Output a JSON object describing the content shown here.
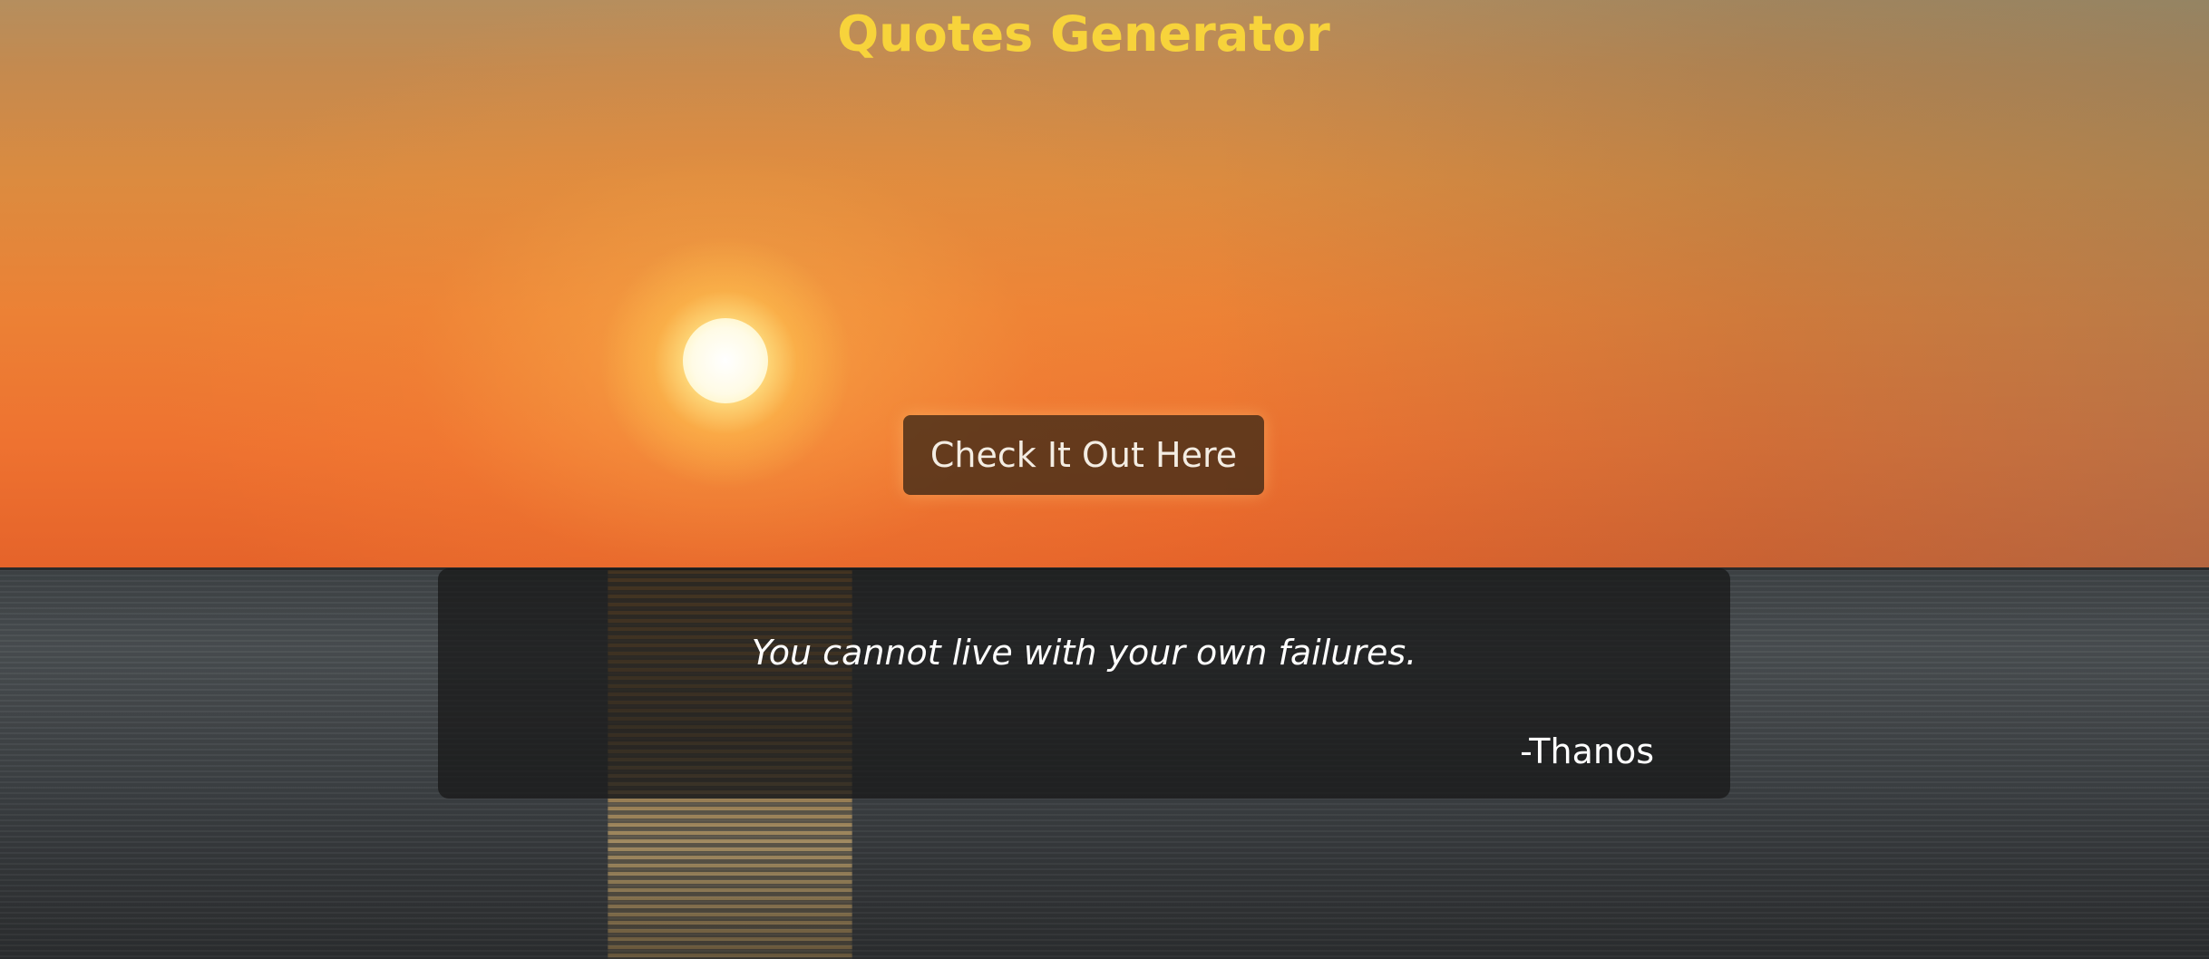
{
  "app": {
    "title": "Quotes Generator"
  },
  "actions": {
    "generate_label": "Check It Out Here"
  },
  "quote": {
    "text": "You cannot live with your own failures.",
    "author": "-Thanos"
  },
  "theme": {
    "title_color": "#f7d33b",
    "button_color": "#462d19",
    "card_color": "#161616",
    "text_color": "#ffffff"
  }
}
